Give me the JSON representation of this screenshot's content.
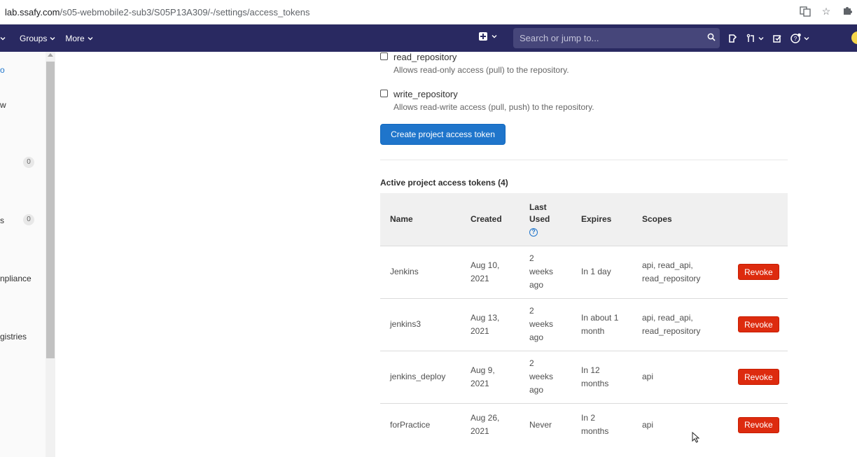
{
  "browser": {
    "url_host": "lab.ssafy.com",
    "url_path": "/s05-webmobile2-sub3/S05P13A309/-/settings/access_tokens"
  },
  "navbar": {
    "groups_label": "Groups",
    "more_label": "More",
    "search_placeholder": "Search or jump to..."
  },
  "sidebar": {
    "fragments": [
      "o",
      "w",
      "s",
      "npliance",
      "gistries"
    ],
    "badges": [
      "0",
      "0"
    ]
  },
  "scopes": [
    {
      "label": "read_repository",
      "description": "Allows read-only access (pull) to the repository."
    },
    {
      "label": "write_repository",
      "description": "Allows read-write access (pull, push) to the repository."
    }
  ],
  "create_button_label": "Create project access token",
  "active_tokens": {
    "title": "Active project access tokens (4)",
    "headers": {
      "name": "Name",
      "created": "Created",
      "last_used": "Last Used",
      "expires": "Expires",
      "scopes": "Scopes"
    },
    "revoke_label": "Revoke",
    "rows": [
      {
        "name": "Jenkins",
        "created": "Aug 10, 2021",
        "last_used": "2 weeks ago",
        "expires": "In 1 day",
        "scopes": "api, read_api, read_repository"
      },
      {
        "name": "jenkins3",
        "created": "Aug 13, 2021",
        "last_used": "2 weeks ago",
        "expires": "In about 1 month",
        "scopes": "api, read_api, read_repository"
      },
      {
        "name": "jenkins_deploy",
        "created": "Aug 9, 2021",
        "last_used": "2 weeks ago",
        "expires": "In 12 months",
        "scopes": "api"
      },
      {
        "name": "forPractice",
        "created": "Aug 26, 2021",
        "last_used": "Never",
        "expires": "In 2 months",
        "scopes": "api"
      }
    ]
  },
  "colors": {
    "navbar": "#292961",
    "primary_button": "#1f75cb",
    "danger_button": "#dd2b0e",
    "expiring_text": "#c17d10"
  }
}
